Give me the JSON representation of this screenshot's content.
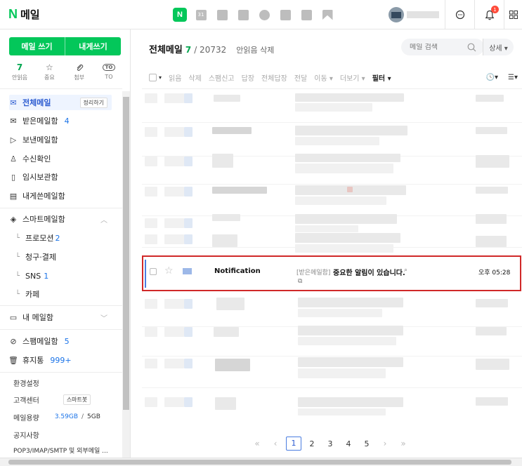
{
  "header": {
    "logo_letter": "N",
    "app_name": "메일",
    "calendar_num": "31",
    "notif_count": "1",
    "mail_logo_letter": "N"
  },
  "sidebar": {
    "write_mail": "메일 쓰기",
    "write_self": "내게쓰기",
    "quick": [
      {
        "top": "7",
        "label": "안읽음"
      },
      {
        "top": "☆",
        "label": "중요"
      },
      {
        "top": "⌕",
        "label": "첨부"
      },
      {
        "top": "TO",
        "label": "TO"
      }
    ],
    "all_mail": "전체메일",
    "organize": "정리하기",
    "inbox": "받은메일함",
    "inbox_count": "4",
    "sent": "보낸메일함",
    "receipt": "수신확인",
    "drafts": "임시보관함",
    "self_mail": "내게쓴메일함",
    "smart": "스마트메일함",
    "promo": "프로모션",
    "promo_count": "2",
    "billing": "청구·결제",
    "sns": "SNS",
    "sns_count": "1",
    "cafe": "카페",
    "my_folders": "내 메일함",
    "spam": "스팸메일함",
    "spam_count": "5",
    "trash": "휴지통",
    "trash_count": "999+",
    "settings": "환경설정",
    "support": "고객센터",
    "smartbot": "스마트봇",
    "storage_label": "메일용량",
    "storage_used": "3.59GB",
    "storage_sep": "/",
    "storage_total": "5GB",
    "notice": "공지사항",
    "pop3": "POP3/IMAP/SMTP 및 외부메일 ..."
  },
  "main": {
    "title": "전체메일",
    "unread_count": "7",
    "total": "/ 20732",
    "delete_unread": "안읽음 삭제",
    "search_placeholder": "메일 검색",
    "detail": "상세 ▾",
    "toolbar": {
      "read": "읽음",
      "delete": "삭제",
      "spam": "스팸신고",
      "reply": "답장",
      "reply_all": "전체답장",
      "forward": "전달",
      "move": "이동 ▾",
      "more": "더보기 ▾",
      "filter": "필터 ▾",
      "clock": "🕓▾",
      "menu": "☰▾"
    },
    "highlighted": {
      "sender": "Notification",
      "tag": "[받은메일함]",
      "subject": "중요한 알림이 있습니다.",
      "time": "오후 05:28"
    },
    "pager": {
      "first": "«",
      "prev": "‹",
      "pages": [
        "1",
        "2",
        "3",
        "4",
        "5"
      ],
      "next": "›",
      "last": "»"
    }
  }
}
